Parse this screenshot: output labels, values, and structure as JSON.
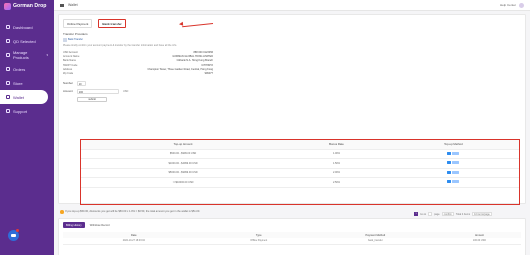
{
  "app": {
    "name": "Gorman Drop"
  },
  "topbar": {
    "breadcrumb": "Wallet",
    "help": "Help Center",
    "user": ""
  },
  "sidebar": {
    "items": [
      {
        "label": "Dashboard"
      },
      {
        "label": "QD Selected"
      },
      {
        "label": "Manage Products"
      },
      {
        "label": "Orders"
      },
      {
        "label": "Store"
      },
      {
        "label": "Wallet"
      },
      {
        "label": "Support"
      }
    ]
  },
  "tabs": [
    {
      "label": "Online Payment"
    },
    {
      "label": "Bank transfer"
    }
  ],
  "bank": {
    "section_title": "Transfer Providers",
    "logo_text": "Bank Transfer",
    "instruction": "Please kindly confirm your account payment & transfer by the transfer information and have all the info.",
    "details": [
      {
        "label": "USD Account",
        "value": "888 000 0123456"
      },
      {
        "label": "Account Name",
        "value": "GORMAN GLOBAL HONG LIMITED"
      },
      {
        "label": "Bank Name",
        "value": "Citibank N.A. Hong Kong Branch"
      },
      {
        "label": "SWIFT Code",
        "value": "CITIHKHX"
      },
      {
        "label": "Address",
        "value": "Champion Tower, Three Garden Road, Central, Hong Kong"
      },
      {
        "label": "Zip Code",
        "value": "999077"
      }
    ]
  },
  "form": {
    "number_label": "Number",
    "number_value": "10",
    "amount_label": "Amount",
    "amount_value": "100",
    "amount_unit": "USD",
    "submit_label": "submit"
  },
  "rates": {
    "headers": [
      "Top-up Amount",
      "Bonus Rate",
      "Top-up Method"
    ],
    "rows": [
      {
        "amount": "$500.00 - $999.00 USD",
        "bonus": "1.00%"
      },
      {
        "amount": "$1000.00 - $4999.00 USD",
        "bonus": "1.50%"
      },
      {
        "amount": "$5000.00 - $9999.00 USD",
        "bonus": "2.00%"
      },
      {
        "amount": ">=$10000.00 USD",
        "bonus": "2.50%"
      }
    ]
  },
  "note": "If you top-up $50.00, discounts you get will be $50.00 x 1.0% = $0.50, the total amount you get in the wallet is $51.00.",
  "pager": {
    "current": "1",
    "goto": "Go to",
    "page": "page",
    "confirm": "confirm",
    "total": "Total 4 Items",
    "per_page": "10 items/page"
  },
  "history": {
    "tabs": [
      {
        "label": "Billing History"
      },
      {
        "label": "Withdraw Record"
      }
    ],
    "headers": [
      "Date",
      "Type",
      "Payment Method",
      "Amount"
    ],
    "rows": [
      {
        "date": "2022-10-27 18:03:04",
        "type": "Offline Payment",
        "method": "bank_transfer",
        "amount": "100.00 USD"
      }
    ]
  }
}
